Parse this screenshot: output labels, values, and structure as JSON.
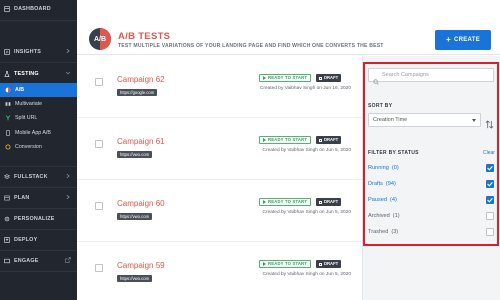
{
  "sidebar": {
    "dashboard": "DASHBOARD",
    "insights": "INSIGHTS",
    "testing": "TESTING",
    "testing_items": [
      "A/B",
      "Multivariate",
      "Split URL",
      "Mobile App A/B",
      "Conversion"
    ],
    "fullstack": "FULLSTACK",
    "plan": "PLAN",
    "personalize": "PERSONALIZE",
    "deploy": "DEPLOY",
    "engage": "ENGAGE"
  },
  "header": {
    "logo_text": "A/B",
    "title": "A/B TESTS",
    "subtitle": "TEST MULTIPLE VARIATIONS OF YOUR LANDING PAGE AND FIND WHICH ONE CONVERTS THE BEST",
    "create_label": "CREATE",
    "create_icon": "+"
  },
  "campaigns": [
    {
      "name": "Campaign 62",
      "url": "https://google.com",
      "status": "READY TO START",
      "state": "DRAFT",
      "created": "Created by Vaibhav Singh on Jun 16, 2020"
    },
    {
      "name": "Campaign 61",
      "url": "https://vwo.com",
      "status": "READY TO START",
      "state": "DRAFT",
      "created": "Created by Vaibhav Singh on Jun 5, 2020"
    },
    {
      "name": "Campaign 60",
      "url": "https://vwo.com",
      "status": "READY TO START",
      "state": "DRAFT",
      "created": "Created by Vaibhav Singh on Jun 5, 2020"
    },
    {
      "name": "Campaign 59",
      "url": "https://vwo.com",
      "status": "READY TO START",
      "state": "DRAFT",
      "created": "Created by Vaibhav Singh on Jun 5, 2020"
    }
  ],
  "filters": {
    "search_placeholder": "Search Campaigns",
    "sort_label": "SORT BY",
    "sort_value": "Creation Time",
    "filter_label": "FILTER BY STATUS",
    "clear_label": "Clear",
    "statuses": [
      {
        "label": "Running",
        "count": "(0)",
        "checked": true
      },
      {
        "label": "Drafts",
        "count": "(94)",
        "checked": true
      },
      {
        "label": "Paused",
        "count": "(4)",
        "checked": true
      },
      {
        "label": "Archived",
        "count": "(1)",
        "checked": false
      },
      {
        "label": "Trashed",
        "count": "(3)",
        "checked": false
      }
    ]
  },
  "colors": {
    "sidebar_bg": "#22262e",
    "accent": "#1a73d9",
    "brand_red": "#e2574c",
    "highlight_box": "#d9202a",
    "ready_green": "#2f9d55"
  }
}
